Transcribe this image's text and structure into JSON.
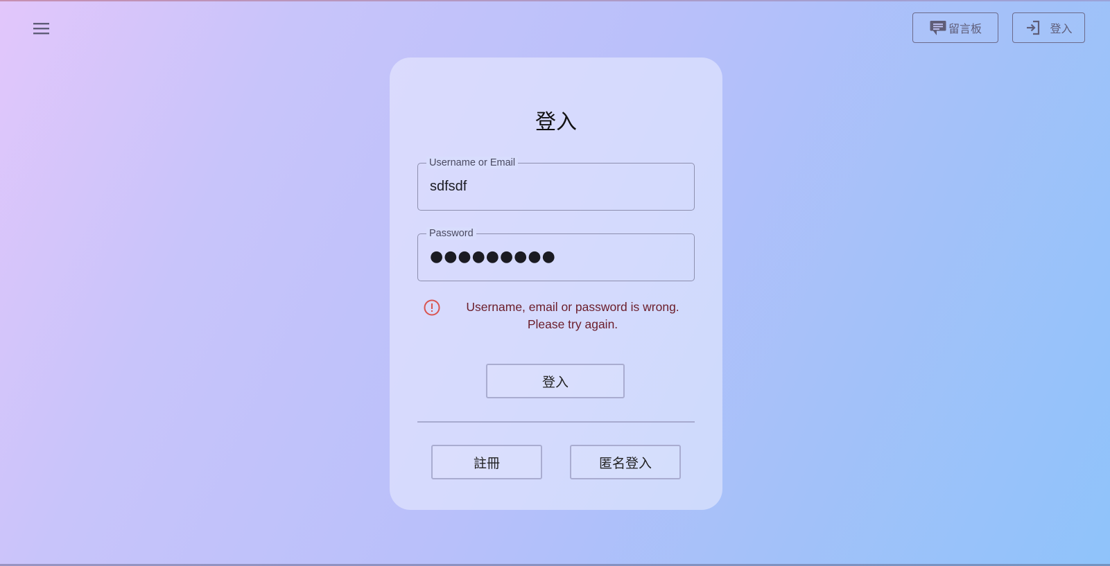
{
  "header": {
    "menu_icon": "hamburger-menu-icon",
    "message_board": {
      "label": "留言板",
      "icon": "chat-bubble-icon"
    },
    "login": {
      "label": "登入",
      "icon": "login-arrow-icon"
    }
  },
  "card": {
    "title": "登入",
    "username_field": {
      "label": "Username or Email",
      "value": "sdfsdf"
    },
    "password_field": {
      "label": "Password",
      "masked_value": "●●●●●●●●●"
    },
    "error": {
      "icon": "alert-circle-icon",
      "line1": "Username, email or password is wrong.",
      "line2": "Please try again.",
      "color": "#6b1d2a",
      "icon_color": "#d9534f"
    },
    "login_button_label": "登入",
    "register_button_label": "註冊",
    "anonymous_login_button_label": "匿名登入"
  }
}
